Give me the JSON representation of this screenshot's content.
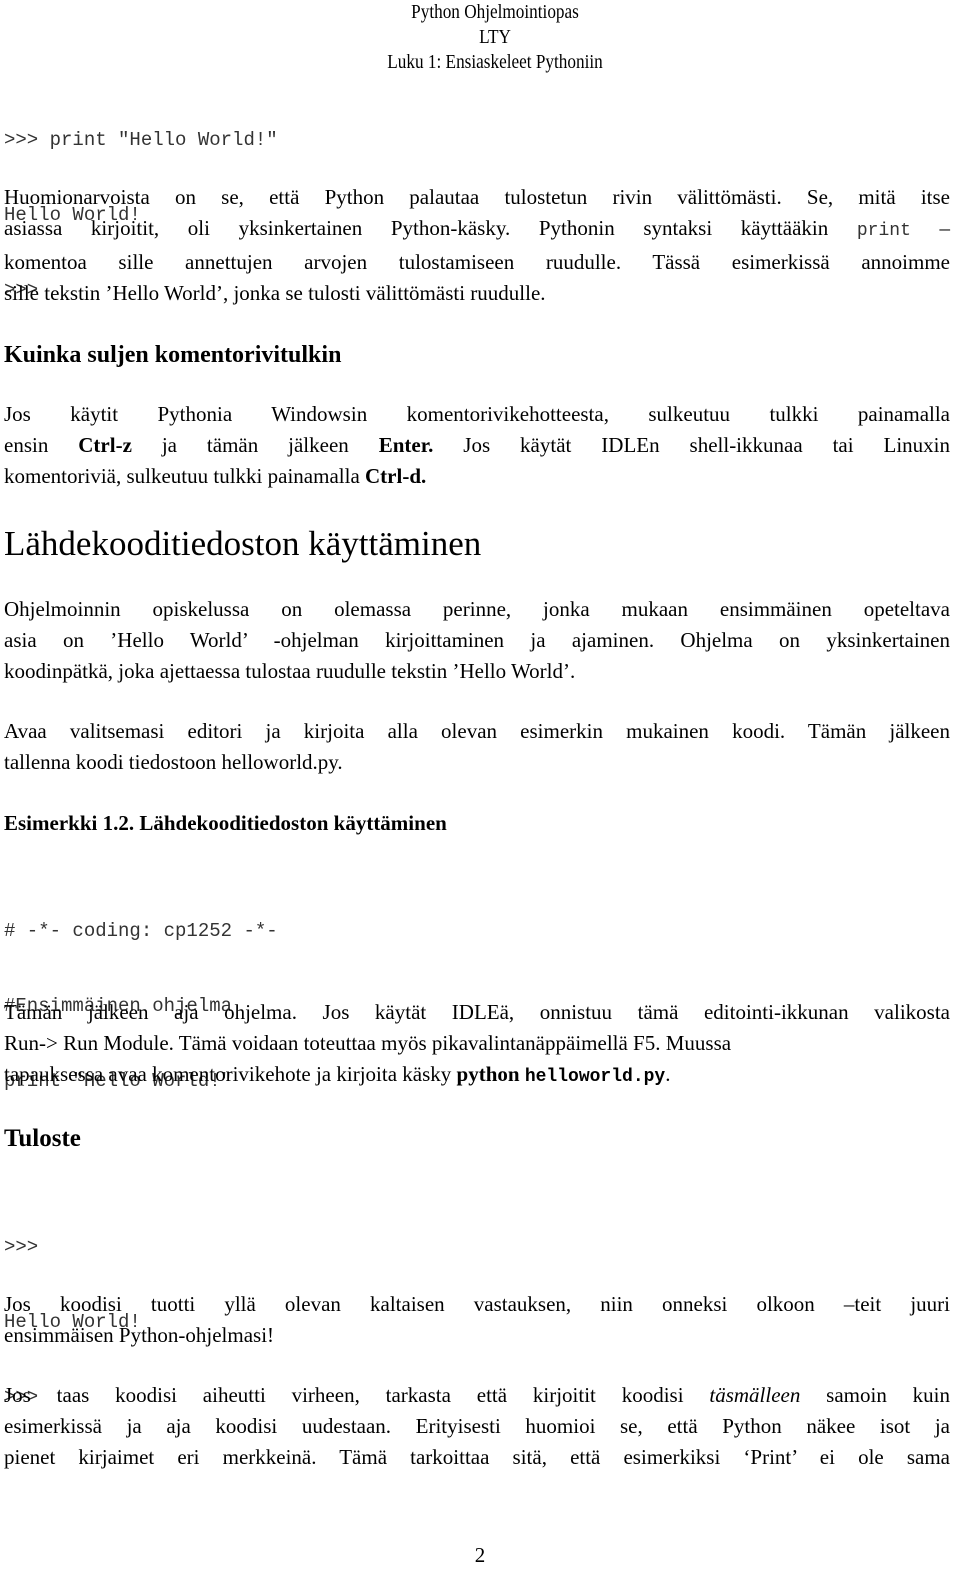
{
  "header": {
    "title": "Python Ohjelmointiopas",
    "org": "LTY",
    "chapter": "Luku 1: Ensiaskeleet Pythoniin"
  },
  "repl_example": {
    "lines": [
      ">>> print \"Hello World!\"",
      "Hello World!",
      ">>>"
    ]
  },
  "para1": {
    "lines": [
      "Huomionarvoista on se, että Python palautaa tulostetun rivin välittömästi. Se, mitä itse",
      "asiassa kirjoitit, oli yksinkertainen Python-käsky. Pythonin syntaksi käyttääkin",
      "print",
      "–",
      "komentoa sille annettujen arvojen tulostamiseen ruudulle. Tässä esimerkissä annoimme",
      "sille tekstin ’Hello World’, jonka se tulosti välittömästi ruudulle."
    ]
  },
  "section_close": {
    "heading": "Kuinka suljen komentorivitulkin",
    "p_line1": "Jos käytit Pythonia Windowsin komentorivikehotteesta, sulkeutuu tulkki painamalla",
    "p_line2_a": "ensin ",
    "p_line2_key1": "Ctrl-z",
    "p_line2_b": " ja tämän jälkeen ",
    "p_line2_key2": "Enter.",
    "p_line2_c": "  Jos käytät IDLEn shell-ikkunaa tai Linuxin",
    "p_line3_a": "komentoriviä, sulkeutuu tulkki painamalla ",
    "p_line3_key": "Ctrl-d."
  },
  "section_source": {
    "heading": "Lähdekooditiedoston käyttäminen",
    "p1_lines": [
      "Ohjelmoinnin opiskelussa on olemassa perinne, jonka mukaan ensimmäinen opeteltava",
      "asia on ’Hello World’ -ohjelman kirjoittaminen ja ajaminen. Ohjelma on yksinkertainen",
      "koodinpätkä, joka ajettaessa tulostaa ruudulle tekstin ’Hello World’."
    ],
    "p2_lines": [
      "Avaa valitsemasi editori ja kirjoita alla olevan esimerkin mukainen koodi. Tämän jälkeen",
      "tallenna koodi tiedostoon helloworld.py."
    ],
    "example_heading": "Esimerkki 1.2. Lähdekooditiedoston käyttäminen",
    "code_lines": [
      "# -*- coding: cp1252 -*-",
      "#Ensimmäinen ohjelma",
      "print \"Hello World!\""
    ],
    "p3_line1": "Tämän jälkeen aja ohjelma. Jos käytät IDLEä, onnistuu tämä editointi-ikkunan valikosta",
    "p3_line2": "Run-> Run Module. Tämä voidaan toteuttaa myös pikavalintanäppäimellä F5. Muussa",
    "p3_line3_a": "tapauksessa avaa komentorivikehote ja kirjoita käsky ",
    "p3_line3_cmd": "python",
    "p3_line3_file": "helloworld.py",
    "p3_line3_end": "."
  },
  "section_output": {
    "heading": "Tuloste",
    "output_lines": [
      ">>>",
      "Hello World!",
      ">>>"
    ],
    "p1_lines": [
      "Jos koodisi tuotti yllä olevan kaltaisen vastauksen, niin onneksi olkoon –teit juuri",
      "ensimmäisen Python-ohjelmasi!"
    ],
    "p2_line1_a": "Jos taas koodisi aiheutti virheen, tarkasta että kirjoitit koodisi ",
    "p2_line1_em": "täsmälleen",
    "p2_line1_b": " samoin kuin",
    "p2_line2": "esimerkissä ja aja koodisi uudestaan. Erityisesti huomioi se, että Python näkee isot ja",
    "p2_line3": "pienet kirjaimet eri merkkeinä. Tämä tarkoittaa sitä, että esimerkiksi ‘Print’ ei ole sama"
  },
  "footer": {
    "page_number": "2"
  }
}
